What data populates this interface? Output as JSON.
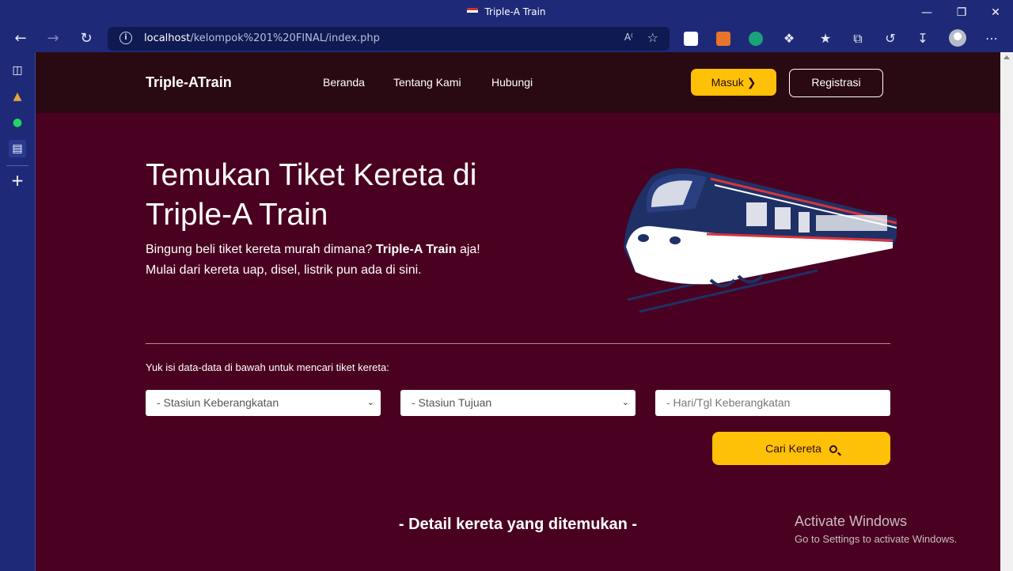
{
  "window": {
    "title": "Triple-A Train"
  },
  "browser": {
    "url_host": "localhost",
    "url_path": "/kelompok%201%20FINAL/index.php"
  },
  "site": {
    "brand": "Triple-ATrain",
    "nav": [
      {
        "label": "Beranda"
      },
      {
        "label": "Tentang Kami"
      },
      {
        "label": "Hubungi"
      }
    ],
    "login_label": "Masuk",
    "register_label": "Registrasi"
  },
  "hero": {
    "title_line1": "Temukan Tiket Kereta di",
    "title_line2": "Triple-A Train",
    "sub_a": "Bingung beli tiket kereta murah dimana? ",
    "sub_brand": "Triple-A Train",
    "sub_b": " aja!",
    "sub_line2": "Mulai dari kereta uap, disel, listrik pun ada di sini."
  },
  "form": {
    "label": "Yuk isi data-data di bawah untuk mencari tiket kereta:",
    "departure_value": "- Stasiun Keberangkatan",
    "destination_value": "- Stasiun Tujuan",
    "date_placeholder": "- Hari/Tgl Keberangkatan",
    "search_label": "Cari Kereta"
  },
  "results": {
    "heading": "- Detail kereta yang ditemukan -"
  },
  "watermark": {
    "line1": "Activate Windows",
    "line2": "Go to Settings to activate Windows."
  },
  "colors": {
    "chrome": "#1e2a78",
    "page_bg": "#4a0020",
    "navbar_bg": "#2a0a12",
    "accent": "#ffc107"
  }
}
